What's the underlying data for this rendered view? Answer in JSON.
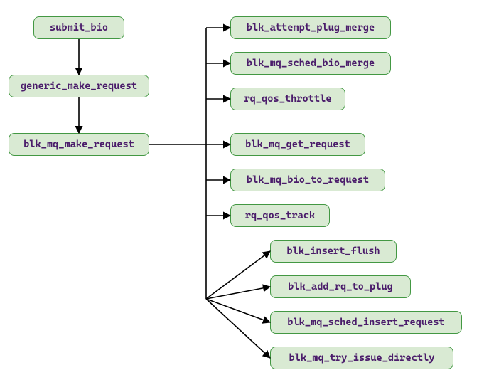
{
  "nodes": {
    "submit_bio": "submit_bio",
    "generic_make_request": "generic_make_request",
    "blk_mq_make_request": "blk_mq_make_request",
    "blk_attempt_plug_merge": "blk_attempt_plug_merge",
    "blk_mq_sched_bio_merge": "blk_mq_sched_bio_merge",
    "rq_qos_throttle": "rq_qos_throttle",
    "blk_mq_get_request": "blk_mq_get_request",
    "blk_mq_bio_to_request": "blk_mq_bio_to_request",
    "rq_qos_track": "rq_qos_track",
    "blk_insert_flush": "blk_insert_flush",
    "blk_add_rq_to_plug": "blk_add_rq_to_plug",
    "blk_mq_sched_insert_request": "blk_mq_sched_insert_request",
    "blk_mq_try_issue_directly": "blk_mq_try_issue_directly"
  },
  "edges": [
    {
      "from": "submit_bio",
      "to": "generic_make_request",
      "style": "arrow"
    },
    {
      "from": "generic_make_request",
      "to": "blk_mq_make_request",
      "style": "arrow"
    },
    {
      "from": "blk_mq_make_request",
      "to": "blk_attempt_plug_merge",
      "style": "arrow"
    },
    {
      "from": "blk_mq_make_request",
      "to": "blk_mq_sched_bio_merge",
      "style": "arrow"
    },
    {
      "from": "blk_mq_make_request",
      "to": "rq_qos_throttle",
      "style": "arrow"
    },
    {
      "from": "blk_mq_make_request",
      "to": "blk_mq_get_request",
      "style": "arrow"
    },
    {
      "from": "blk_mq_make_request",
      "to": "blk_mq_bio_to_request",
      "style": "arrow"
    },
    {
      "from": "blk_mq_make_request",
      "to": "rq_qos_track",
      "style": "arrow"
    },
    {
      "from": "blk_mq_make_request",
      "to": "blk_insert_flush",
      "style": "arrow"
    },
    {
      "from": "blk_mq_make_request",
      "to": "blk_add_rq_to_plug",
      "style": "arrow"
    },
    {
      "from": "blk_mq_make_request",
      "to": "blk_mq_sched_insert_request",
      "style": "arrow"
    },
    {
      "from": "blk_mq_make_request",
      "to": "blk_mq_try_issue_directly",
      "style": "arrow"
    }
  ]
}
